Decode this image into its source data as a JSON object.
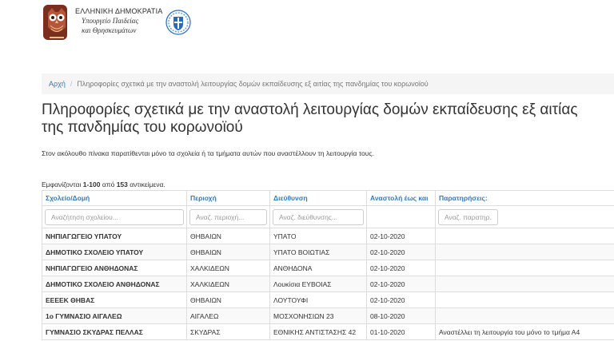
{
  "header": {
    "line1": "ΕΛΛΗΝΙΚΗ ΔΗΜΟΚΡΑΤΙΑ",
    "line2": "Υπουργείο Παιδείας",
    "line3": "και Θρησκευμάτων",
    "logo_icon": "owl-logo-icon",
    "emblem_icon": "greek-emblem-icon"
  },
  "breadcrumb": {
    "home": "Αρχή",
    "separator": "/",
    "current": "Πληροφορίες σχετικά με την αναστολή λειτουργίας δομών εκπαίδευσης εξ αιτίας της πανδημίας του κορωνοϊού"
  },
  "page": {
    "title": "Πληροφορίες σχετικά με την αναστολή λειτουργίας δομών εκπαίδευσης εξ αιτίας της πανδημίας του κορωνοϊού",
    "intro": "Στον ακόλουθο πίνακα παρατίθενται μόνο τα σχολεία ή τα τμήματα αυτών που αναστέλλουν τη λειτουργία τους.",
    "summary_prefix": "Εμφανίζονται ",
    "summary_range": "1-100",
    "summary_mid": " από ",
    "summary_total": "153",
    "summary_suffix": " αντικείμενα."
  },
  "table": {
    "columns": [
      "Σχολείο/Δομή",
      "Περιοχή",
      "Διεύθυνση",
      "Αναστολή έως και",
      "Παρατηρήσεις:"
    ],
    "filters": {
      "school": "Αναζήτηση σχολείου...",
      "area": "Αναζ. περιοχή...",
      "address": "Αναζ. διεύθυνσης...",
      "notes": "Αναζ. παρατηρ..."
    },
    "rows": [
      {
        "school": "ΝΗΠΙΑΓΩΓΕΙΟ ΥΠΑΤΟΥ",
        "area": "ΘΗΒΑΙΩΝ",
        "address": "ΥΠΑΤΟ",
        "until": "02-10-2020",
        "notes": ""
      },
      {
        "school": "ΔΗΜΟΤΙΚΟ ΣΧΟΛΕΙΟ ΥΠΑΤΟΥ",
        "area": "ΘΗΒΑΙΩΝ",
        "address": "ΥΠΑΤΟ ΒΟΙΩΤΙΑΣ",
        "until": "02-10-2020",
        "notes": ""
      },
      {
        "school": "ΝΗΠΙΑΓΩΓΕΙΟ ΑΝΘΗΔΟΝΑΣ",
        "area": "ΧΑΛΚΙΔΕΩΝ",
        "address": "ΑΝΘΗΔΟΝΑ",
        "until": "02-10-2020",
        "notes": ""
      },
      {
        "school": "ΔΗΜΟΤΙΚΟ ΣΧΟΛΕΙΟ ΑΝΘΗΔΟΝΑΣ",
        "area": "ΧΑΛΚΙΔΕΩΝ",
        "address": "Λουκίσια ΕΥΒΟΙΑΣ",
        "until": "02-10-2020",
        "notes": ""
      },
      {
        "school": "ΕΕΕΕΚ ΘΗΒΑΣ",
        "area": "ΘΗΒΑΙΩΝ",
        "address": "ΛΟΥΤΟΥΦΙ",
        "until": "02-10-2020",
        "notes": ""
      },
      {
        "school": "1ο ΓΥΜΝΑΣΙΟ ΑΙΓΑΛΕΩ",
        "area": "ΑΙΓΑΛΕΩ",
        "address": "ΜΟΣΧΟΝΗΣΙΩΝ 23",
        "until": "08-10-2020",
        "notes": ""
      },
      {
        "school": "ΓΥΜΝΑΣΙΟ ΣΚΥΔΡΑΣ ΠΕΛΛΑΣ",
        "area": "ΣΚΥΔΡΑΣ",
        "address": "ΕΘΝΙΚΗΣ ΑΝΤΙΣΤΑΣΗΣ 42",
        "until": "01-10-2020",
        "notes": "Αναστέλλει τη λειτουργία του μόνο το τμήμα Α4"
      }
    ]
  }
}
